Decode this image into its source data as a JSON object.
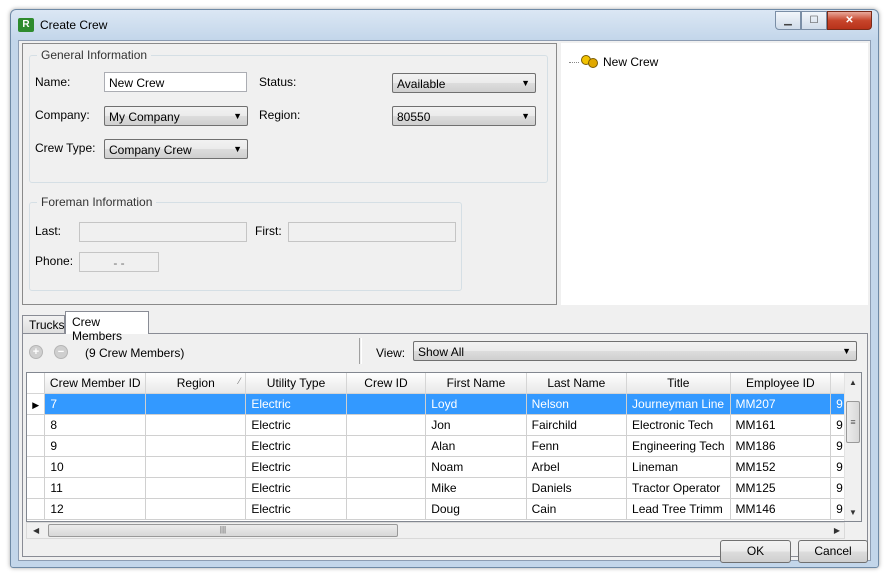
{
  "window": {
    "title": "Create Crew",
    "icon_text": "R"
  },
  "general": {
    "group_title": "General Information",
    "name_label": "Name:",
    "name_value": "New Crew",
    "status_label": "Status:",
    "status_value": "Available",
    "company_label": "Company:",
    "company_value": "My Company",
    "region_label": "Region:",
    "region_value": "80550",
    "crew_type_label": "Crew Type:",
    "crew_type_value": "Company Crew"
  },
  "foreman": {
    "group_title": "Foreman Information",
    "last_label": "Last:",
    "last_value": "",
    "first_label": "First:",
    "first_value": "",
    "phone_label": "Phone:",
    "phone_value": "-   -"
  },
  "tree": {
    "root_label": "New Crew"
  },
  "tabs": [
    {
      "label": "Trucks",
      "active": false
    },
    {
      "label": "Crew Members",
      "active": true
    }
  ],
  "crew_members": {
    "count_label": "(9 Crew Members)",
    "view_label": "View:",
    "view_value": "Show All",
    "columns": [
      "Crew Member ID",
      "Region",
      "Utility Type",
      "Crew ID",
      "First Name",
      "Last Name",
      "Title",
      "Employee ID",
      ""
    ],
    "rows": [
      [
        "7",
        "",
        "Electric",
        "",
        "Loyd",
        "Nelson",
        "Journeyman Line",
        "MM207",
        "9"
      ],
      [
        "8",
        "",
        "Electric",
        "",
        "Jon",
        "Fairchild",
        "Electronic Tech",
        "MM161",
        "9"
      ],
      [
        "9",
        "",
        "Electric",
        "",
        "Alan",
        "Fenn",
        "Engineering Tech",
        "MM186",
        "9"
      ],
      [
        "10",
        "",
        "Electric",
        "",
        "Noam",
        "Arbel",
        "Lineman",
        "MM152",
        "9"
      ],
      [
        "11",
        "",
        "Electric",
        "",
        "Mike",
        "Daniels",
        "Tractor Operator",
        "MM125",
        "9"
      ],
      [
        "12",
        "",
        "Electric",
        "",
        "Doug",
        "Cain",
        "Lead Tree Trimm",
        "MM146",
        "9"
      ]
    ],
    "selected_row": 0
  },
  "buttons": {
    "ok": "OK",
    "cancel": "Cancel"
  },
  "icons": {
    "add": "add-icon",
    "remove": "remove-icon",
    "crew": "crew-icon",
    "row_pointer": "row-pointer-icon"
  }
}
